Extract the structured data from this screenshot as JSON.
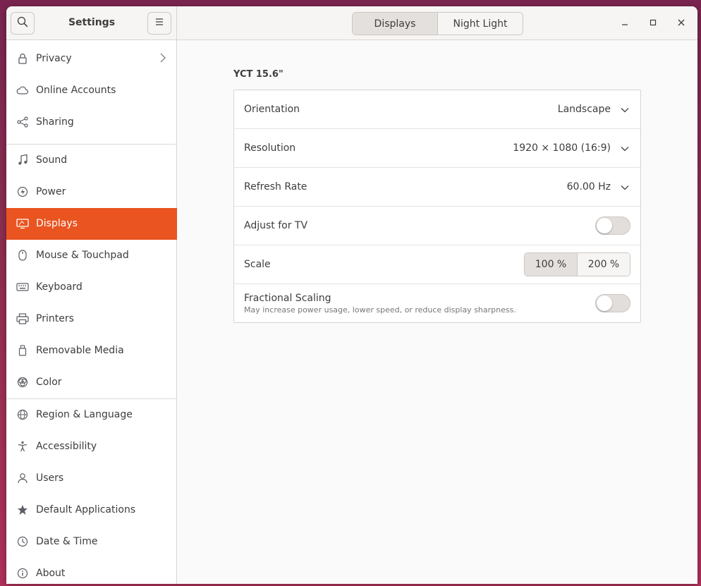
{
  "window": {
    "title": "Settings"
  },
  "header": {
    "tabs": [
      {
        "label": "Displays",
        "active": true
      },
      {
        "label": "Night Light",
        "active": false
      }
    ]
  },
  "sidebar": {
    "items": [
      {
        "label": "Privacy",
        "icon": "lock-icon",
        "has_chevron": true
      },
      {
        "label": "Online Accounts",
        "icon": "cloud-icon"
      },
      {
        "label": "Sharing",
        "icon": "share-icon"
      },
      {
        "label": "Sound",
        "icon": "music-note-icon"
      },
      {
        "label": "Power",
        "icon": "power-icon"
      },
      {
        "label": "Displays",
        "icon": "display-icon",
        "active": true
      },
      {
        "label": "Mouse & Touchpad",
        "icon": "mouse-icon"
      },
      {
        "label": "Keyboard",
        "icon": "keyboard-icon"
      },
      {
        "label": "Printers",
        "icon": "printer-icon"
      },
      {
        "label": "Removable Media",
        "icon": "removable-media-icon"
      },
      {
        "label": "Color",
        "icon": "color-icon"
      },
      {
        "label": "Region & Language",
        "icon": "globe-icon"
      },
      {
        "label": "Accessibility",
        "icon": "accessibility-icon"
      },
      {
        "label": "Users",
        "icon": "users-icon"
      },
      {
        "label": "Default Applications",
        "icon": "star-icon"
      },
      {
        "label": "Date & Time",
        "icon": "clock-icon"
      },
      {
        "label": "About",
        "icon": "info-icon"
      }
    ]
  },
  "display": {
    "monitor_name": "YCT 15.6\"",
    "orientation": {
      "label": "Orientation",
      "value": "Landscape"
    },
    "resolution": {
      "label": "Resolution",
      "value": "1920 × 1080 (16:9)"
    },
    "refresh_rate": {
      "label": "Refresh Rate",
      "value": "60.00 Hz"
    },
    "adjust_tv": {
      "label": "Adjust for TV",
      "enabled": false
    },
    "scale": {
      "label": "Scale",
      "options": [
        "100 %",
        "200 %"
      ],
      "selected": "100 %"
    },
    "fractional_scaling": {
      "label": "Fractional Scaling",
      "description": "May increase power usage, lower speed, or reduce display sharpness.",
      "enabled": false
    }
  },
  "colors": {
    "accent": "#e95420"
  }
}
